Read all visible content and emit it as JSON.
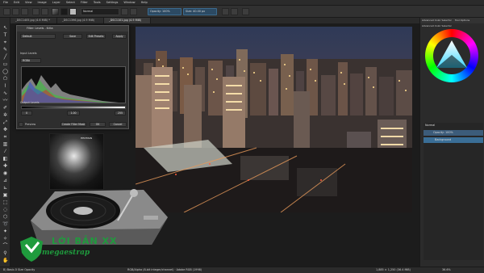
{
  "menubar": {
    "items": [
      "File",
      "Edit",
      "View",
      "Image",
      "Layer",
      "Select",
      "Filter",
      "Tools",
      "Settings",
      "Window",
      "Help"
    ]
  },
  "toolbar": {
    "blend_mode": "Normal",
    "opacity": "Opacity: 100%",
    "size": "Size: 40.00 px"
  },
  "tabs": [
    {
      "label": "_DSC1405.jpg (4.6 MiB) *",
      "active": false
    },
    {
      "label": "_DSC1396.jpg (4.9 MiB)",
      "active": false
    },
    {
      "label": "_DSC1101.jpg (4.9 MiB)",
      "active": true
    }
  ],
  "dialog": {
    "title": "Filter: Levels - Krita",
    "preset": "Default",
    "btn_save": "Save",
    "btn_edit": "Edit Presets",
    "btn_apply": "Apply",
    "input_label": "Input Levels",
    "channel": "RGBA",
    "in_min": "0",
    "in_gamma": "1.00",
    "in_max": "255",
    "output_label": "Output Levels",
    "out_min": "0",
    "out_max": "255",
    "chk_preview": "Preview",
    "btn_mask": "Create Filter Mask",
    "btn_ok": "OK",
    "btn_cancel": "Cancel"
  },
  "dock": {
    "tabs": [
      "Advanced Color Selector",
      "Tool Options"
    ],
    "panel_title": "Advanced Color Selector",
    "blend_mode": "Normal",
    "opacity": "Opacity: 100%",
    "layers": [
      {
        "name": "Background",
        "selected": true
      }
    ]
  },
  "status": {
    "left": "B) Basic-5 Size Opacity",
    "center": "RGB/Alpha (8-bit integer/channel) · Adobe RGB (1998)",
    "right_dims": "1,885 × 1,250 (36.4 MiB)",
    "zoom": "36.6%"
  },
  "overlay": {
    "monitor_caption": "HELTMAN",
    "watermark_line1": "LỚI BẢN XX",
    "watermark_line2": "megaestrap"
  },
  "colors": {
    "accent": "#3a6e96",
    "watermark": "#1f9b3d"
  }
}
